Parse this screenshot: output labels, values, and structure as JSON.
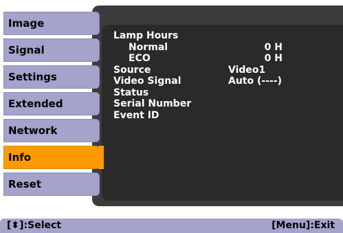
{
  "sidebar": {
    "items": [
      {
        "label": "Image"
      },
      {
        "label": "Signal"
      },
      {
        "label": "Settings"
      },
      {
        "label": "Extended"
      },
      {
        "label": "Network"
      },
      {
        "label": "Info",
        "active": true
      },
      {
        "label": "Reset"
      }
    ]
  },
  "info": {
    "lamp_hours": "Lamp Hours",
    "normal_label": "Normal",
    "normal_value": "0 H",
    "eco_label": "ECO",
    "eco_value": "0 H",
    "source_label": "Source",
    "source_value": "Video1",
    "video_signal_label": "Video Signal",
    "video_signal_value": "Auto (----)",
    "status_label": "Status",
    "serial_label": "Serial Number",
    "event_label": "Event ID"
  },
  "footer": {
    "select_hint": "[⬍]:Select",
    "exit_hint": "[Menu]:Exit"
  },
  "colors": {
    "menu": "#a3a3cc",
    "active": "#ff9a00",
    "panel": "#3c3c3c"
  }
}
